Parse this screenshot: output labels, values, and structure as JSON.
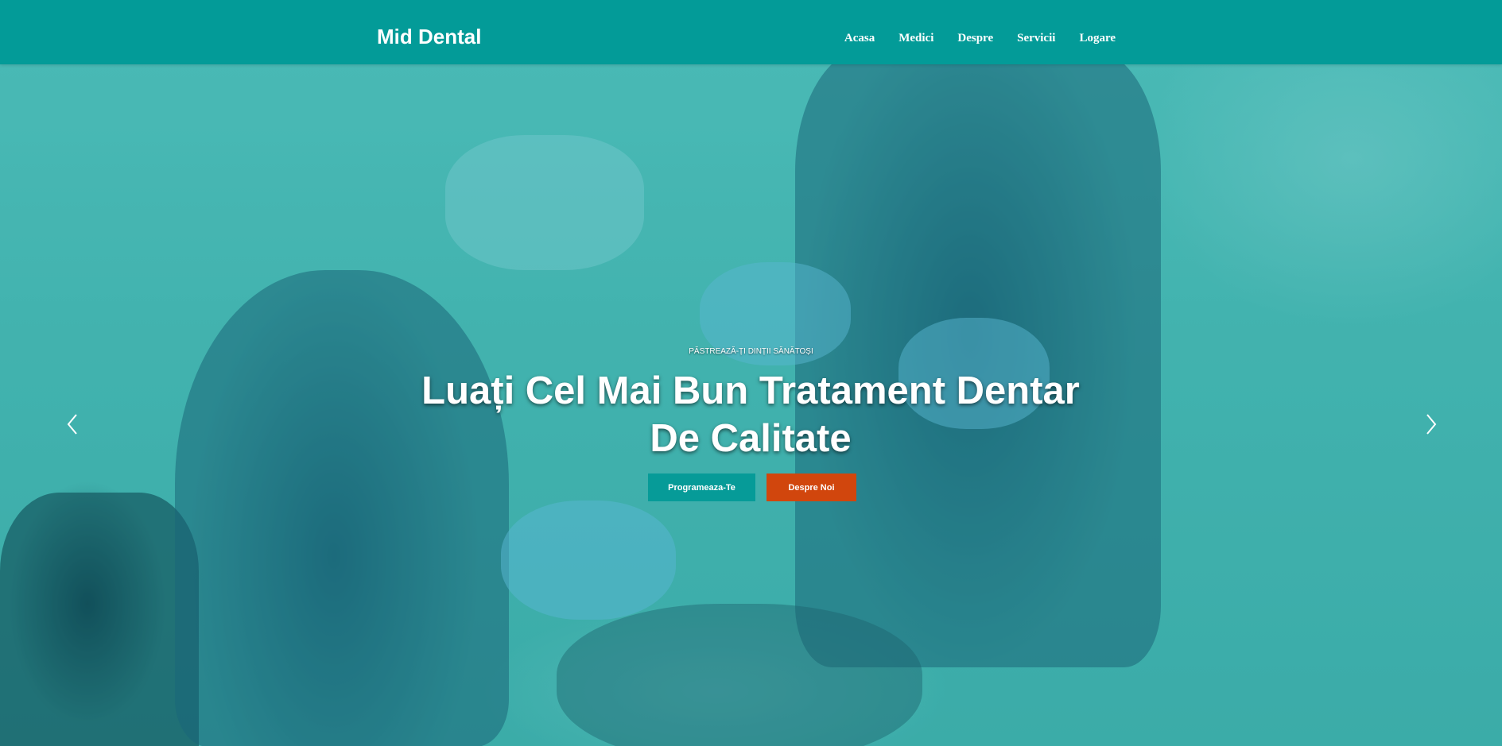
{
  "navbar": {
    "brand": "Mid Dental",
    "links": [
      {
        "label": "Acasa"
      },
      {
        "label": "Medici"
      },
      {
        "label": "Despre"
      },
      {
        "label": "Servicii"
      },
      {
        "label": "Logare"
      }
    ],
    "background_color": "#039b98"
  },
  "hero": {
    "eyebrow": "PĂSTREAZĂ-ȚI DINȚII SĂNĂTOȘI",
    "headline_line1": "Luați Cel Mai Bun Tratament Dentar",
    "headline_line2": "De Calitate",
    "primary_button": "Programeaza-Te",
    "secondary_button": "Despre Noi",
    "primary_color": "#069b98",
    "secondary_color": "#d1460d",
    "prev_icon": "chevron-left-icon",
    "next_icon": "chevron-right-icon"
  }
}
